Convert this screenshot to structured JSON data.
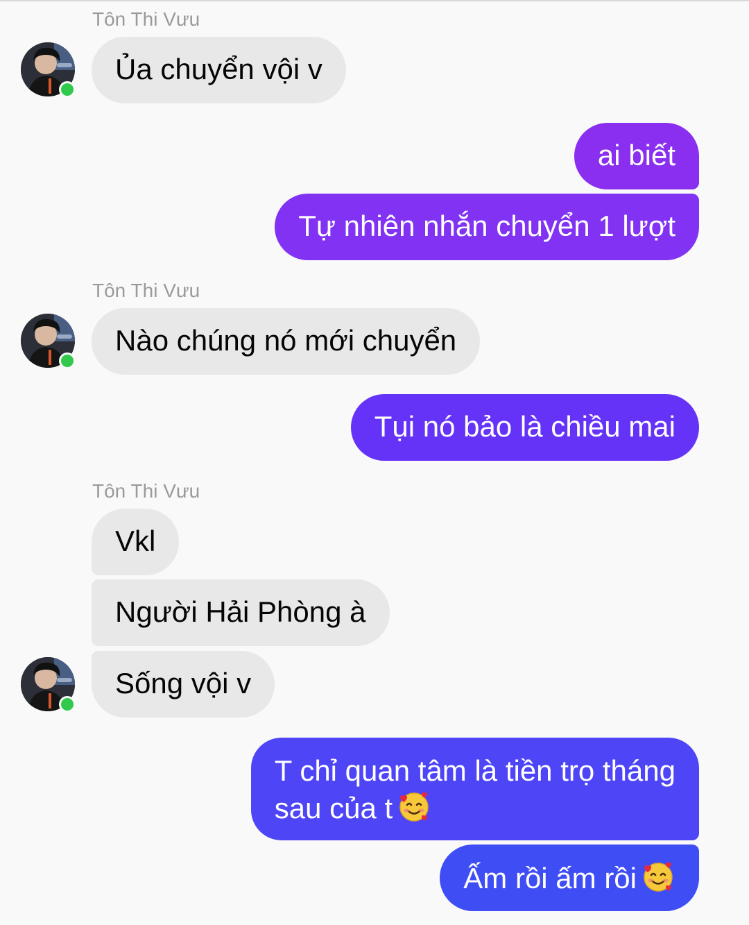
{
  "contact": {
    "name": "Tôn Thi Vưu",
    "online_color": "#31c94b"
  },
  "colors": {
    "incoming_bubble": "#e8e8e8",
    "outgoing_gradient": [
      "#8a2ff0",
      "#6533f7",
      "#4d45f6",
      "#3f4df4"
    ]
  },
  "messages": [
    {
      "text": "Ủa chuyển vội v"
    },
    {
      "text": "ai biết"
    },
    {
      "text": "Tự nhiên nhắn chuyển 1 lượt"
    },
    {
      "text": "Nào chúng nó mới chuyển"
    },
    {
      "text": "Tụi nó bảo là chiều mai"
    },
    {
      "text": "Vkl"
    },
    {
      "text": "Người Hải Phòng à"
    },
    {
      "text": "Sống vội v"
    },
    {
      "line1": "T chỉ quan tâm là tiền trọ tháng",
      "line2": "sau của t",
      "emoji": "smiling-face-with-hearts"
    },
    {
      "text": "Ấm rồi ấm rồi",
      "emoji": "smiling-face-with-hearts"
    }
  ]
}
